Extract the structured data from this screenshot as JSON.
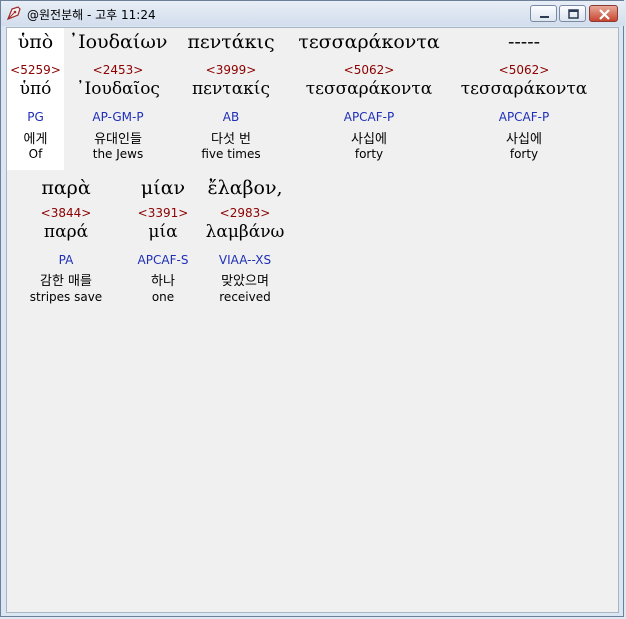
{
  "window": {
    "title": "@원전분해 - 고후 11:24",
    "icon": "pen-nib-icon",
    "controls": [
      "minimize-icon",
      "maximize-icon",
      "close-icon"
    ]
  },
  "row1": [
    {
      "greek": "ὑπὸ",
      "strong": "<5259>",
      "lemma": "ὑπό",
      "parse": "PG",
      "korean": "에게",
      "english": "Of"
    },
    {
      "greek": "᾿Ιουδαίων",
      "strong": "<2453>",
      "lemma": "᾿Ιουδαῖος",
      "parse": "AP-GM-P",
      "korean": "유대인들",
      "english": "the Jews"
    },
    {
      "greek": "πεντάκις",
      "strong": "<3999>",
      "lemma": "πεντακίς",
      "parse": "AB",
      "korean": "다섯 번",
      "english": "five times"
    },
    {
      "greek": "τεσσαράκοντα",
      "strong": "<5062>",
      "lemma": "τεσσαράκοντα",
      "parse": "APCAF-P",
      "korean": "사십에",
      "english": "forty"
    },
    {
      "greek": "-----",
      "strong": "<5062>",
      "lemma": "τεσσαράκοντα",
      "parse": "APCAF-P",
      "korean": "사십에",
      "english": "forty"
    }
  ],
  "row2": [
    {
      "greek": "παρὰ",
      "strong": "<3844>",
      "lemma": "παρά",
      "parse": "PA",
      "korean": "감한 매를",
      "english": "stripes save"
    },
    {
      "greek": "μίαν",
      "strong": "<3391>",
      "lemma": "μία",
      "parse": "APCAF-S",
      "korean": "하나",
      "english": "one"
    },
    {
      "greek": "ἔλαβον,",
      "strong": "<2983>",
      "lemma": "λαμβάνω",
      "parse": "VIAA--XS",
      "korean": "맞았으며",
      "english": "received"
    }
  ]
}
